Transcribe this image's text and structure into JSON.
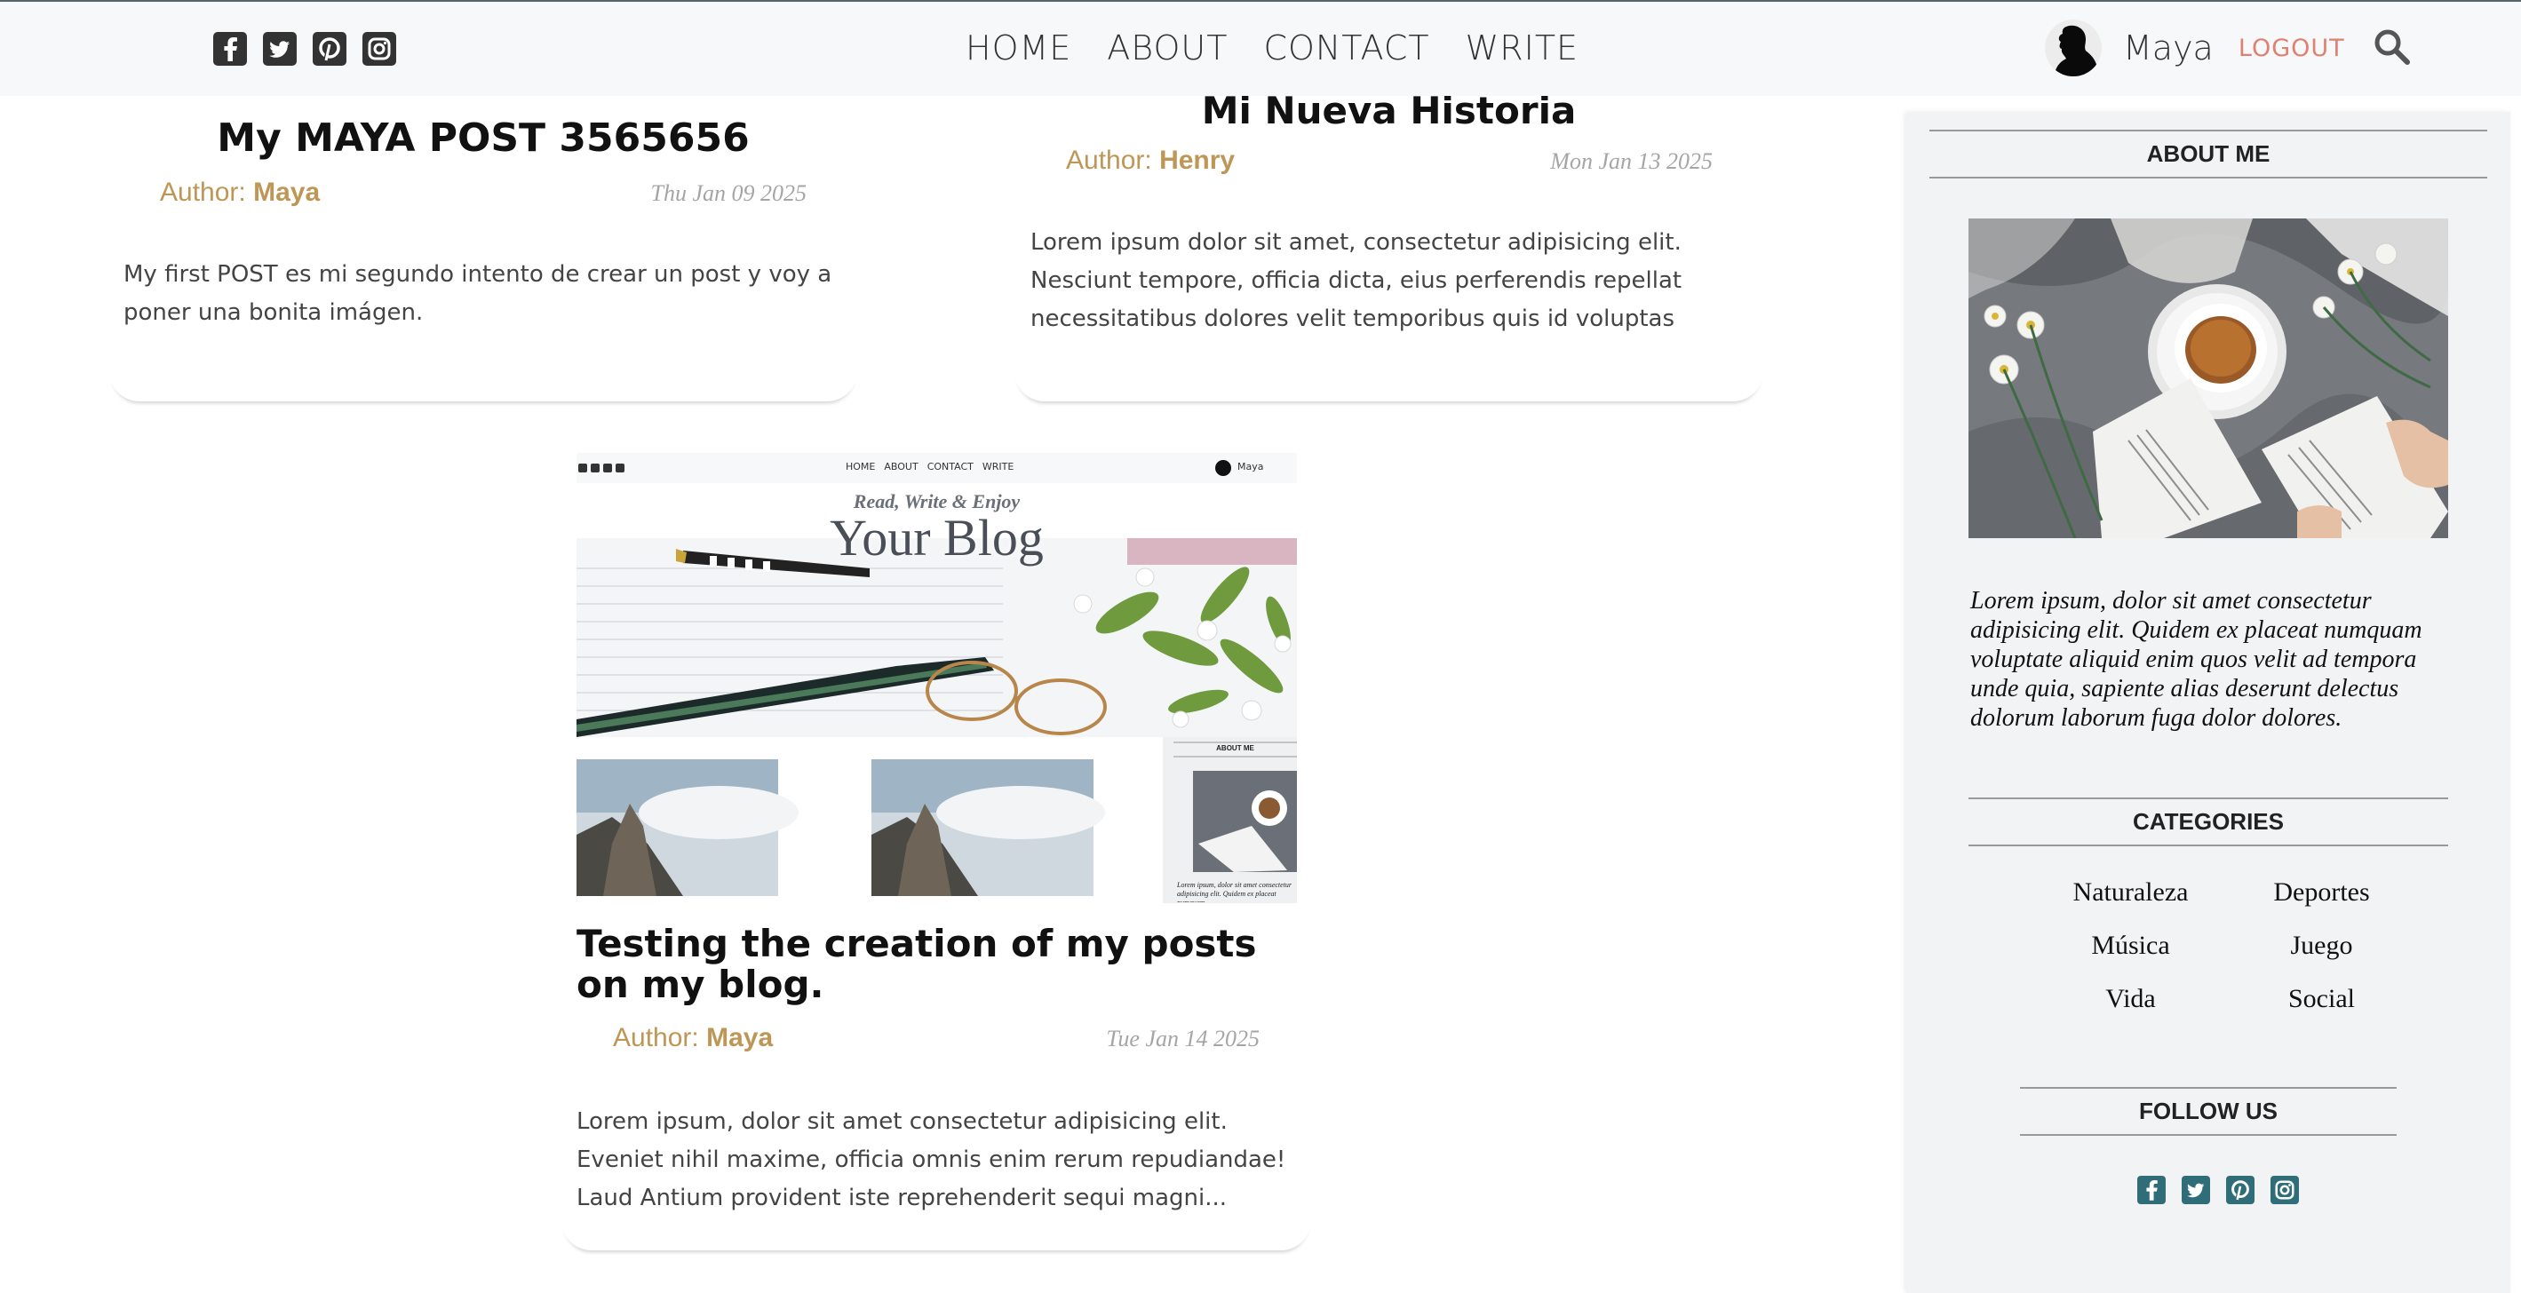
{
  "nav": {
    "items": [
      "HOME",
      "ABOUT",
      "CONTACT",
      "WRITE"
    ]
  },
  "social": [
    "facebook-icon",
    "twitter-icon",
    "pinterest-icon",
    "instagram-icon"
  ],
  "user": {
    "name": "Maya",
    "logout_label": "LOGOUT"
  },
  "posts": [
    {
      "title": "My MAYA POST 3565656",
      "author_prefix": "Author:",
      "author": "Maya",
      "date": "Thu Jan 09 2025",
      "excerpt": "My first POST es mi segundo intento de crear un post y voy a poner una bonita imágen."
    },
    {
      "title": "Mi Nueva Historia",
      "author_prefix": "Author:",
      "author": "Henry",
      "date": "Mon Jan 13 2025",
      "excerpt": "Lorem ipsum dolor sit amet, consectetur adipisicing elit. Nesciunt tempore, officia dicta, eius perferendis repellat necessitatibus dolores velit temporibus quis id voluptas odio?..."
    },
    {
      "title": "Testing the creation of my posts on my blog.",
      "author_prefix": "Author:",
      "author": "Maya",
      "date": "Tue Jan 14 2025",
      "excerpt": "Lorem ipsum, dolor sit amet consectetur adipisicing elit. Eveniet nihil maxime, officia omnis enim rerum repudiandae! Laud Antium provident iste reprehenderit sequi magni..."
    }
  ],
  "thumbnail": {
    "nav_items": [
      "HOME",
      "ABOUT",
      "CONTACT",
      "WRITE"
    ],
    "user_name": "Maya",
    "tagline": "Read, Write & Enjoy",
    "headline": "Your Blog",
    "sidebar_heading": "ABOUT ME",
    "sidebar_text": "Lorem ipsum, dolor sit amet consectetur adipisicing elit. Quidem ex placeat numquam"
  },
  "sidebar": {
    "about_heading": "ABOUT ME",
    "about_text": "Lorem ipsum, dolor sit amet consectetur adipisicing elit. Quidem ex placeat numquam voluptate aliquid enim quos velit ad tempora unde quia, sapiente alias deserunt delectus dolorum laborum fuga dolor dolores.",
    "categories_heading": "CATEGORIES",
    "categories": [
      "Naturaleza",
      "Deportes",
      "Música",
      "Juego",
      "Vida",
      "Social"
    ],
    "follow_heading": "FOLLOW US",
    "follow_icons": [
      "facebook-icon",
      "twitter-icon",
      "pinterest-icon",
      "instagram-icon"
    ]
  },
  "colors": {
    "accent_author": "#be9656",
    "logout": "#e08070",
    "follow_icon": "#2f6e78"
  }
}
